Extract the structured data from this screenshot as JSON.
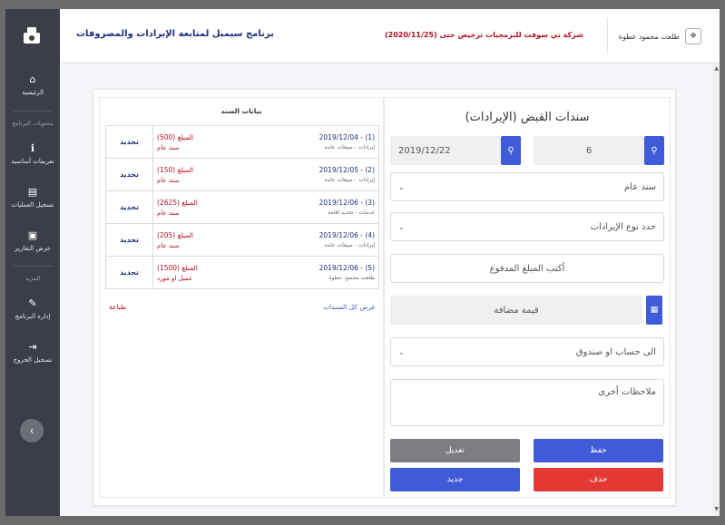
{
  "header": {
    "app_title": "برنامج سيمبل لمتابعة الإيرادات والمصروفات",
    "company": "شركة تي سوفت للبرمجيات ترخيص حتى (2020/11/25)",
    "user": "طلعت محمود عطوة"
  },
  "sidebar": {
    "home": "الرئيسية",
    "section_program": "محتويات البرنامج",
    "basics": "تعريفات أساسية",
    "ops": "تسجيل العمليات",
    "reports": "عرض التقارير",
    "section_more": "المزيد",
    "admin": "إدارة البرنامج",
    "logout": "تسجيل الخروج"
  },
  "list_panel": {
    "title": "بيانات السند",
    "renew_label": "تحديد",
    "rows": [
      {
        "date": "(1) - 2019/12/04",
        "category": "إيرادات - مبيعات عامة",
        "amount": "المبلغ (500)",
        "kind": "سند عام"
      },
      {
        "date": "(2) - 2019/12/05",
        "category": "إيرادات - مبيعات عامة",
        "amount": "المبلغ (150)",
        "kind": "سند عام"
      },
      {
        "date": "(3) - 2019/12/06",
        "category": "خدمات - تجديد اقامة",
        "amount": "المبلغ (2625)",
        "kind": "سند عام"
      },
      {
        "date": "(4) - 2019/12/06",
        "category": "إيرادات - مبيعات عامة",
        "amount": "المبلغ (205)",
        "kind": "سند عام"
      },
      {
        "date": "(5) - 2019/12/06",
        "category": "طلعت محمود عطوة",
        "amount": "المبلغ (1500)",
        "kind": "عميل او مورد"
      }
    ],
    "show_all": "عرض كل السندات",
    "print": "طباعة"
  },
  "form": {
    "title": "سندات القبض (الإيرادات)",
    "number_value": "6",
    "date_value": "2019/12/22",
    "doc_type": "سند عام",
    "revenue_type_placeholder": "حدد نوع الإيرادات",
    "amount_placeholder": "أكتب المبلغ المدفوع",
    "vat_placeholder": "قيمة مضافة",
    "account_placeholder": "الى حساب او صندوق",
    "notes_placeholder": "ملاحظات أخرى",
    "save": "حفظ",
    "edit": "تعديل",
    "delete": "حذف",
    "new": "جديد"
  },
  "colors": {
    "primary": "#3f5bd8",
    "danger": "#e53935",
    "gray": "#7b7d82",
    "sidebar": "#3b3e47"
  },
  "icons": {
    "home": "home-icon",
    "search": "search-icon",
    "calculator": "calculator-icon"
  }
}
